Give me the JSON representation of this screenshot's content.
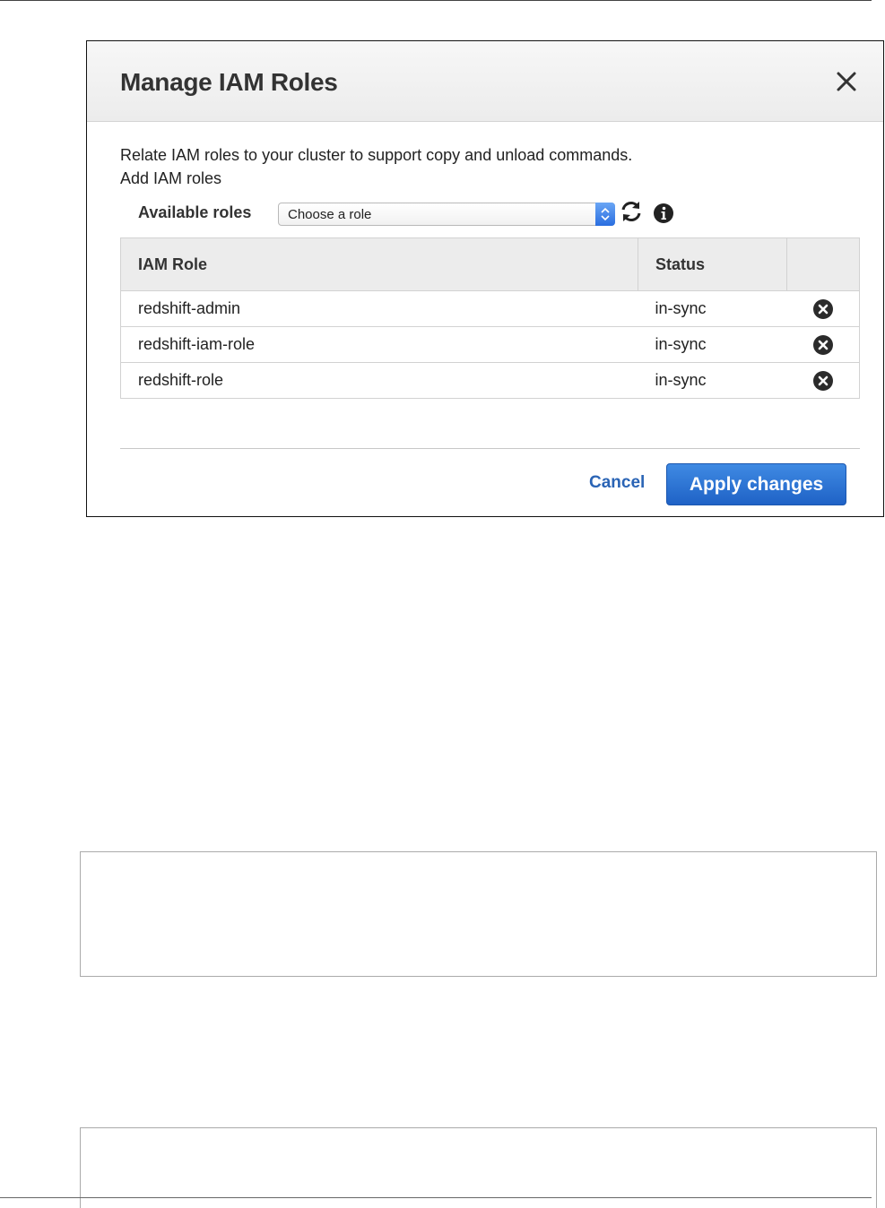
{
  "dialog": {
    "title": "Manage IAM Roles",
    "description": "Relate IAM roles to your cluster to support copy and unload commands.",
    "add_label": "Add IAM roles",
    "available_roles_label": "Available roles",
    "select": {
      "value": "Choose a role"
    },
    "table": {
      "headers": [
        "IAM Role",
        "Status",
        ""
      ],
      "rows": [
        {
          "role": "redshift-admin",
          "status": "in-sync"
        },
        {
          "role": "redshift-iam-role",
          "status": "in-sync"
        },
        {
          "role": "redshift-role",
          "status": "in-sync"
        }
      ]
    },
    "cancel_label": "Cancel",
    "apply_label": "Apply changes"
  },
  "icons": {
    "close": "close-icon",
    "refresh": "refresh-icon",
    "info": "info-icon",
    "remove": "remove-circle-icon",
    "select_arrow": "chevron-updown-icon"
  },
  "colors": {
    "status_ok": "#2d9a2d",
    "primary_button": "#1f62c6",
    "link": "#2a64b5"
  }
}
